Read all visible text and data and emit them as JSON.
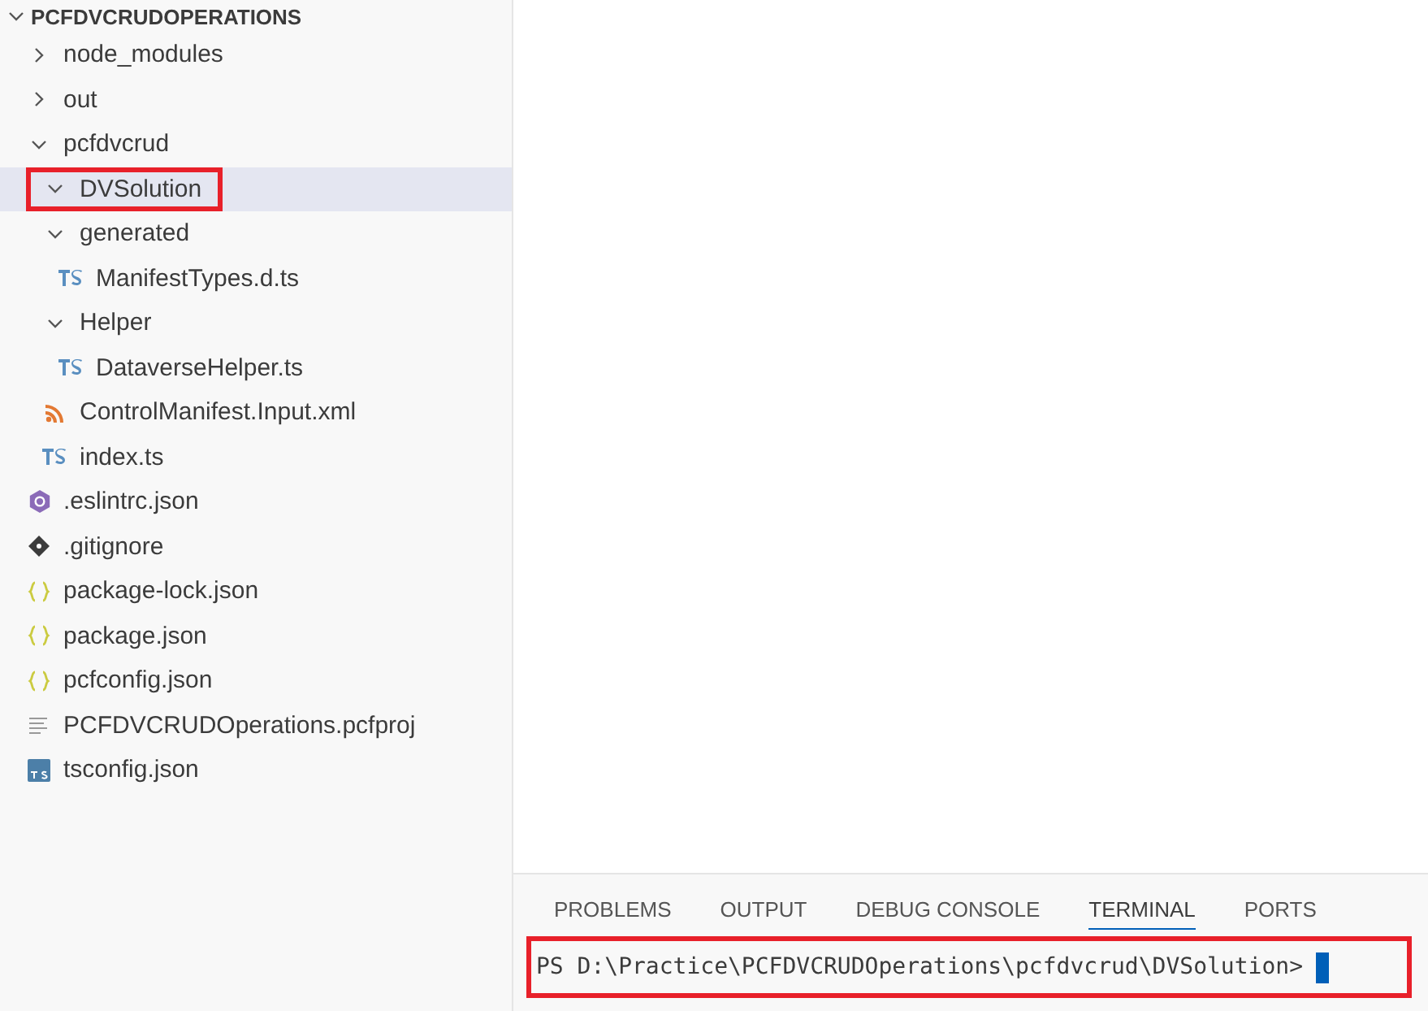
{
  "explorer": {
    "root": {
      "label": "PCFDVCRUDOPERATIONS",
      "expanded": true
    },
    "items": [
      {
        "kind": "folder",
        "label": "node_modules",
        "expanded": false,
        "selected": false,
        "highlighted": false
      },
      {
        "kind": "folder",
        "label": "out",
        "expanded": false,
        "selected": false,
        "highlighted": false
      },
      {
        "kind": "folder",
        "label": "pcfdvcrud",
        "expanded": true,
        "selected": false,
        "highlighted": false,
        "children": [
          {
            "kind": "folder",
            "label": "DVSolution",
            "expanded": true,
            "selected": true,
            "highlighted": true
          },
          {
            "kind": "folder",
            "label": "generated",
            "expanded": true,
            "selected": false,
            "highlighted": false,
            "children": [
              {
                "kind": "ts",
                "label": "ManifestTypes.d.ts",
                "selected": false,
                "highlighted": false
              }
            ]
          },
          {
            "kind": "folder",
            "label": "Helper",
            "expanded": true,
            "selected": false,
            "highlighted": false,
            "children": [
              {
                "kind": "ts",
                "label": "DataverseHelper.ts",
                "selected": false,
                "highlighted": false
              }
            ]
          },
          {
            "kind": "xml",
            "label": "ControlManifest.Input.xml",
            "selected": false,
            "highlighted": false
          },
          {
            "kind": "ts",
            "label": "index.ts",
            "selected": false,
            "highlighted": false
          }
        ]
      },
      {
        "kind": "eslint",
        "label": ".eslintrc.json",
        "selected": false,
        "highlighted": false
      },
      {
        "kind": "git",
        "label": ".gitignore",
        "selected": false,
        "highlighted": false
      },
      {
        "kind": "json",
        "label": "package-lock.json",
        "selected": false,
        "highlighted": false
      },
      {
        "kind": "json",
        "label": "package.json",
        "selected": false,
        "highlighted": false
      },
      {
        "kind": "json",
        "label": "pcfconfig.json",
        "selected": false,
        "highlighted": false
      },
      {
        "kind": "text",
        "label": "PCFDVCRUDOperations.pcfproj",
        "selected": false,
        "highlighted": false
      },
      {
        "kind": "tsconfig",
        "label": "tsconfig.json",
        "selected": false,
        "highlighted": false
      }
    ]
  },
  "panel": {
    "tabs": [
      {
        "label": "PROBLEMS",
        "selected": false
      },
      {
        "label": "OUTPUT",
        "selected": false
      },
      {
        "label": "DEBUG CONSOLE",
        "selected": false
      },
      {
        "label": "TERMINAL",
        "selected": true
      },
      {
        "label": "PORTS",
        "selected": false
      }
    ],
    "terminal": {
      "prompt": "PS D:\\Practice\\PCFDVCRUDOperations\\pcfdvcrud\\DVSolution>",
      "highlighted": true
    }
  }
}
